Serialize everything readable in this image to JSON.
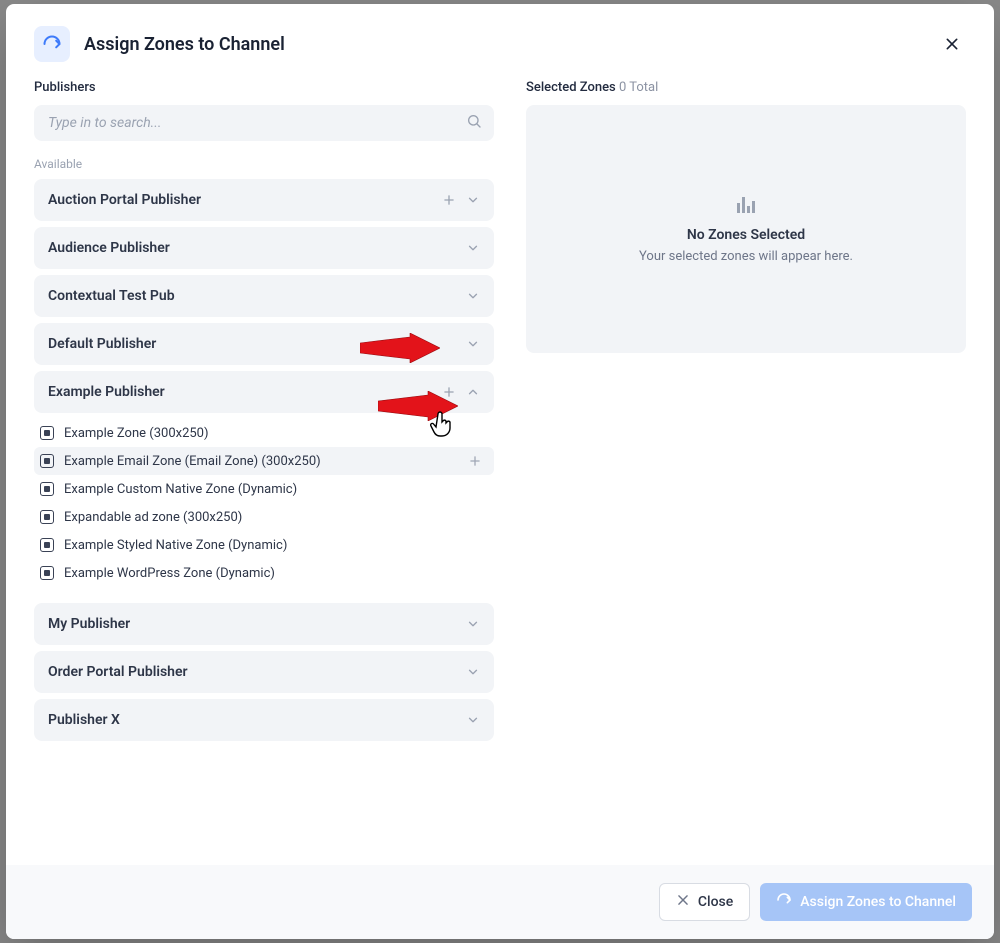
{
  "header": {
    "title": "Assign Zones to Channel"
  },
  "left": {
    "section_label": "Publishers",
    "search_placeholder": "Type in to search...",
    "available_label": "Available",
    "publishers": [
      {
        "name": "Auction Portal Publisher",
        "expanded": false,
        "show_plus": true
      },
      {
        "name": "Audience Publisher",
        "expanded": false,
        "show_plus": false
      },
      {
        "name": "Contextual Test Pub",
        "expanded": false,
        "show_plus": false
      },
      {
        "name": "Default Publisher",
        "expanded": false,
        "show_plus": false
      },
      {
        "name": "Example Publisher",
        "expanded": true,
        "show_plus": true,
        "zones": [
          {
            "name": "Example Zone (300x250)",
            "hovered": false
          },
          {
            "name": "Example Email Zone (Email Zone) (300x250)",
            "hovered": true
          },
          {
            "name": "Example Custom Native Zone (Dynamic)",
            "hovered": false
          },
          {
            "name": "Expandable ad zone (300x250)",
            "hovered": false
          },
          {
            "name": "Example Styled Native Zone (Dynamic)",
            "hovered": false
          },
          {
            "name": "Example WordPress Zone (Dynamic)",
            "hovered": false
          }
        ]
      },
      {
        "name": "My Publisher",
        "expanded": false,
        "show_plus": false
      },
      {
        "name": "Order Portal Publisher",
        "expanded": false,
        "show_plus": false
      },
      {
        "name": "Publisher X",
        "expanded": false,
        "show_plus": false
      }
    ]
  },
  "right": {
    "section_label": "Selected Zones",
    "count_text": "0 Total",
    "empty_title": "No Zones Selected",
    "empty_sub": "Your selected zones will appear here."
  },
  "footer": {
    "close_label": "Close",
    "assign_label": "Assign Zones to Channel"
  }
}
